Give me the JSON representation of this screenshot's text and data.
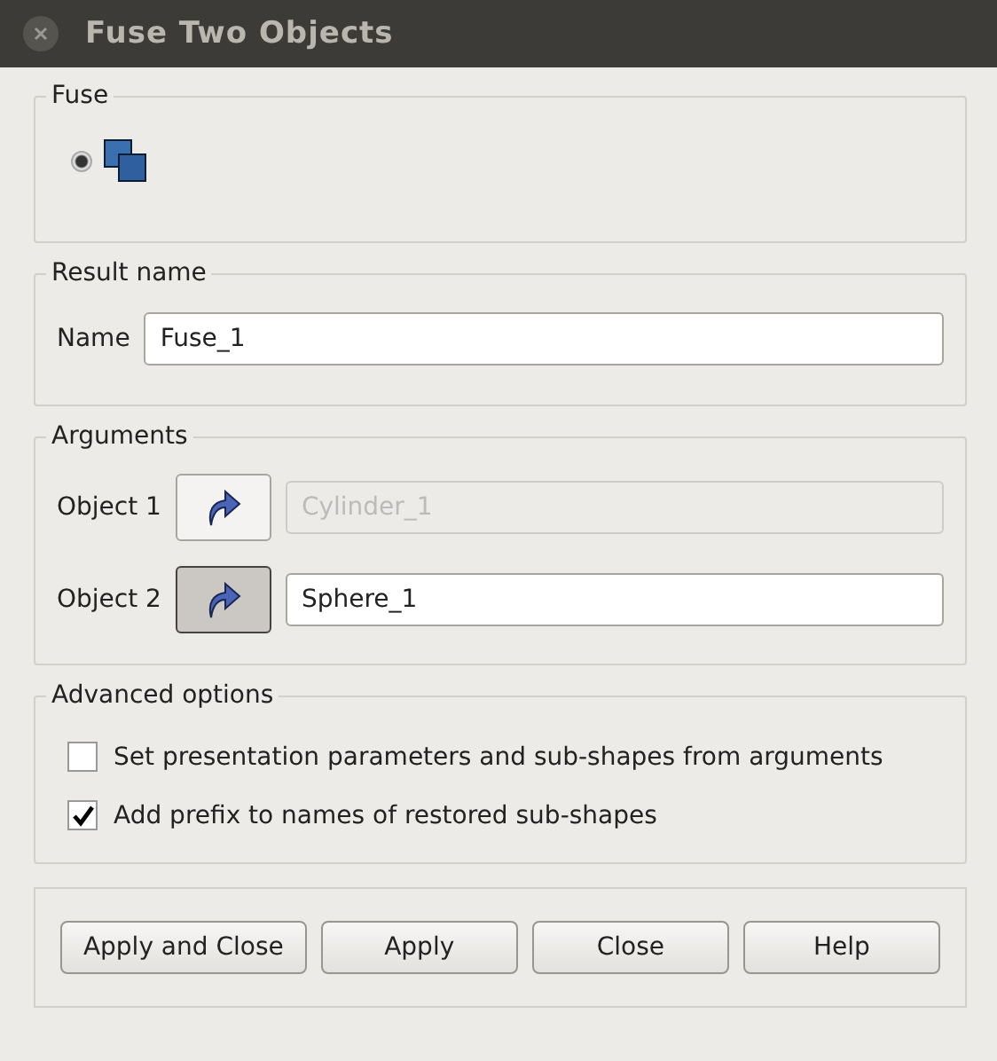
{
  "window": {
    "title": "Fuse Two Objects"
  },
  "fuse": {
    "title": "Fuse",
    "options": [
      {
        "selected": true
      }
    ]
  },
  "result": {
    "title": "Result name",
    "label": "Name",
    "value": "Fuse_1"
  },
  "arguments": {
    "title": "Arguments",
    "objects": [
      {
        "label": "Object 1",
        "selected": false,
        "value": "Cylinder_1",
        "disabled": true
      },
      {
        "label": "Object 2",
        "selected": true,
        "value": "Sphere_1",
        "disabled": false
      }
    ]
  },
  "advanced": {
    "title": "Advanced options",
    "options": [
      {
        "label": "Set presentation parameters and sub-shapes from arguments",
        "checked": false
      },
      {
        "label": "Add prefix to names of restored sub-shapes",
        "checked": true
      }
    ]
  },
  "buttons": [
    "Apply and Close",
    "Apply",
    "Close",
    "Help"
  ]
}
